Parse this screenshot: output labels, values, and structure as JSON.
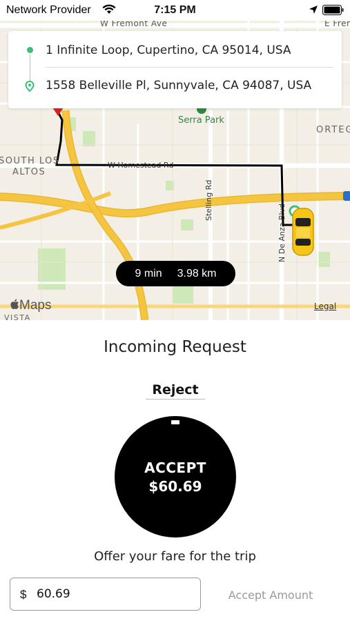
{
  "status_bar": {
    "carrier": "Network Provider",
    "time": "7:15 PM",
    "icons": [
      "wifi-icon",
      "location-arrow-icon",
      "battery-icon"
    ]
  },
  "route": {
    "from_address": "1 Infinite Loop, Cupertino, CA 95014, USA",
    "to_address": "1558 Belleville Pl, Sunnyvale, CA 94087, USA",
    "eta_time": "9 min",
    "eta_distance": "3.98 km"
  },
  "map": {
    "labels": {
      "fremont": "W Fremont Ave",
      "fremont_east": "E Frem",
      "serra_park": "Serra Park",
      "ortega": "ORTEG",
      "south_los": "SOUTH LOS",
      "altos": "ALTOS",
      "homestead": "W Homestead Rd",
      "stelling": "Stelling Rd",
      "de_anza": "N De Anza Blvd",
      "vista": "VISTA"
    },
    "logo_text": "Maps",
    "legal": "Legal",
    "colors": {
      "land": "#f3efe6",
      "highway": "#f5c542",
      "park": "#cfe8b8",
      "route": "#000000",
      "vehicle": "#f5c518",
      "origin": "#3dbf7a",
      "destination_pin": "#e02020"
    }
  },
  "request": {
    "title": "Incoming Request",
    "reject_label": "Reject",
    "accept_label": "ACCEPT",
    "accept_fare": "$60.69",
    "offer_prompt": "Offer your fare for the trip",
    "currency_symbol": "$",
    "fare_value": "60.69",
    "accept_amount_label": "Accept Amount"
  }
}
